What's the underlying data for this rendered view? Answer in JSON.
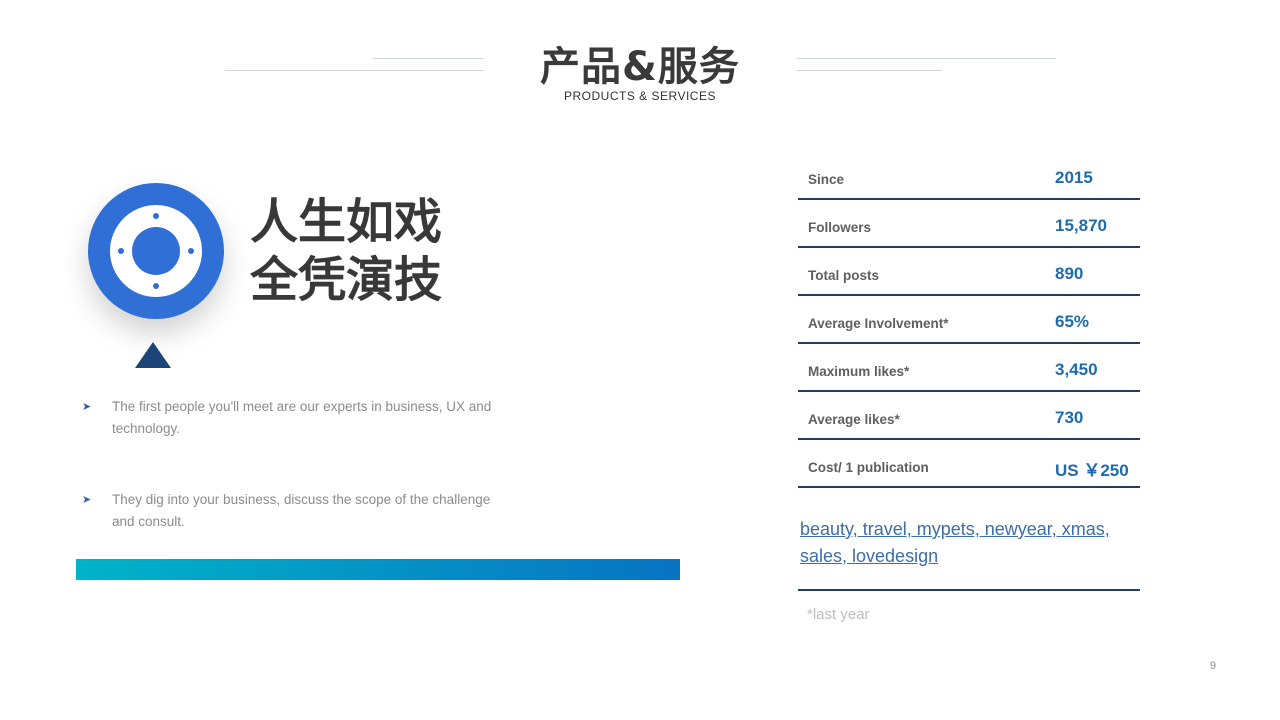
{
  "header": {
    "title": "产品&服务",
    "subtitle": "PRODUCTS & SERVICES"
  },
  "left": {
    "headline_lines": [
      "人生如戏",
      "全凭演技"
    ],
    "bullets": [
      "The first people you'll meet are our experts in business, UX and technology.",
      "They dig into your business, discuss the scope of the challenge and consult."
    ],
    "icon": "target-icon"
  },
  "stats": [
    {
      "label": "Since",
      "value": "2015"
    },
    {
      "label": "Followers",
      "value": "15,870"
    },
    {
      "label": "Total posts",
      "value": "890"
    },
    {
      "label": "Average Involvement*",
      "value": "65%"
    },
    {
      "label": "Maximum likes*",
      "value": "3,450"
    },
    {
      "label": "Average likes*",
      "value": "730"
    },
    {
      "label": "Cost/  1 publication",
      "value": "US ￥250"
    }
  ],
  "tags": "beauty, travel, mypets, newyear, xmas, sales, lovedesign",
  "footnote": "*last year",
  "page_number": "9",
  "colors": {
    "primary_blue": "#2f6fd6",
    "navy": "#1f3f66",
    "value_blue": "#1f6bb0",
    "gradient_start": "#00b4c8",
    "gradient_end": "#0873c2"
  }
}
